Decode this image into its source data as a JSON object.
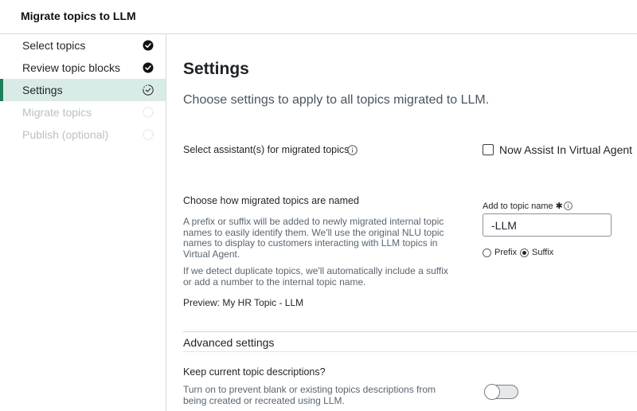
{
  "header": {
    "title": "Migrate topics to LLM"
  },
  "sidebar": {
    "steps": [
      {
        "label": "Select topics",
        "state": "complete",
        "icon": "check-circle-icon"
      },
      {
        "label": "Review topic blocks",
        "state": "complete",
        "icon": "check-circle-icon"
      },
      {
        "label": "Settings",
        "state": "in-progress",
        "icon": "progress-circle-icon"
      },
      {
        "label": "Migrate topics",
        "state": "pending",
        "icon": "dashed-circle-icon"
      },
      {
        "label": "Publish (optional)",
        "state": "pending",
        "icon": "dashed-circle-icon"
      }
    ]
  },
  "main": {
    "title": "Settings",
    "subtitle": "Choose settings to apply to all topics migrated to LLM.",
    "assistant": {
      "label": "Select assistant(s) for migrated topics",
      "option_label": "Now Assist In Virtual Agent",
      "checked": false
    },
    "naming": {
      "title": "Choose how migrated topics are named",
      "description": "A prefix or suffix will be added to newly migrated internal topic names to easily identify them. We'll use the original NLU topic names to display to customers interacting with LLM topics in Virtual Agent.",
      "duplicate_note": "If we detect duplicate topics, we'll automatically include a suffix or add a number to the internal topic name.",
      "preview": "Preview: My HR Topic - LLM",
      "field_label": "Add to topic name",
      "required_mark": "✱",
      "field_value": "-LLM",
      "radio_prefix": "Prefix",
      "radio_suffix": "Suffix",
      "selected": "Suffix"
    },
    "advanced": {
      "title": "Advanced settings",
      "keep_title": "Keep current topic descriptions?",
      "keep_desc": "Turn on to prevent blank or existing topics descriptions from being created or recreated using LLM.",
      "toggle_on": false
    }
  },
  "colors": {
    "accent": "#1f7f5a",
    "active_bg": "#d9ebe6",
    "muted_text": "#5a6570",
    "disabled_text": "#bcc0c4"
  }
}
